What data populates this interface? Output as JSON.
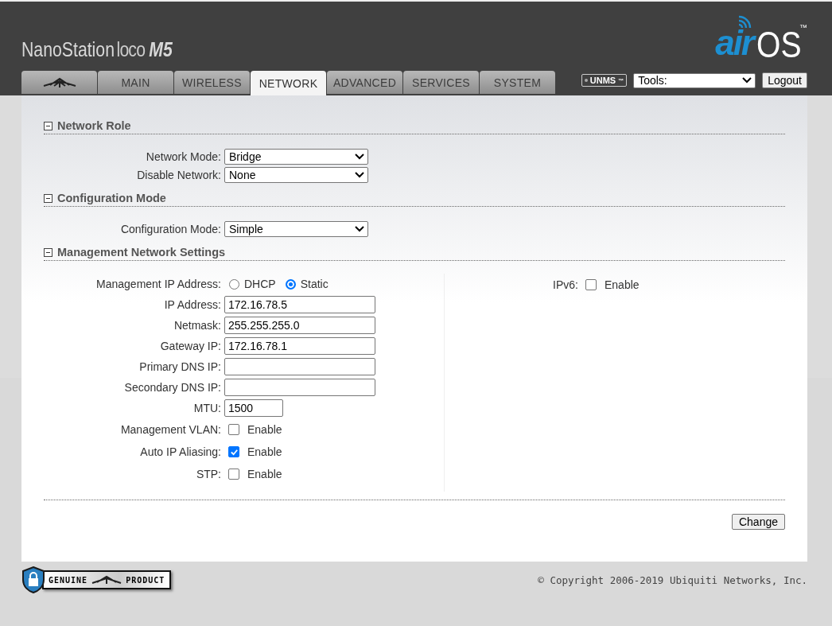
{
  "header": {
    "product_logo": {
      "name": "NanoStation",
      "variant": "loco",
      "model": "M5"
    },
    "brand_logo": {
      "prefix": "air",
      "suffix": "OS",
      "mark": "™"
    }
  },
  "tabs": [
    {
      "kind": "logo",
      "selected": false
    },
    {
      "kind": "text",
      "label": "MAIN",
      "selected": false
    },
    {
      "kind": "text",
      "label": "WIRELESS",
      "selected": false
    },
    {
      "kind": "text",
      "label": "NETWORK",
      "selected": true
    },
    {
      "kind": "text",
      "label": "ADVANCED",
      "selected": false
    },
    {
      "kind": "text",
      "label": "SERVICES",
      "selected": false
    },
    {
      "kind": "text",
      "label": "SYSTEM",
      "selected": false
    }
  ],
  "toolbar": {
    "unms": {
      "label": "UNMS",
      "mark": "™"
    },
    "tools": {
      "value": "Tools:"
    },
    "logout": "Logout"
  },
  "sections": [
    {
      "title": "Network Role",
      "expanded": true,
      "columns": [
        [
          {
            "kind": "select",
            "label": "Network Mode:",
            "value": "Bridge"
          },
          {
            "kind": "select",
            "label": "Disable Network:",
            "value": "None"
          }
        ]
      ]
    },
    {
      "title": "Configuration Mode",
      "expanded": true,
      "columns": [
        [
          {
            "kind": "select",
            "label": "Configuration Mode:",
            "value": "Simple"
          }
        ]
      ]
    },
    {
      "title": "Management Network Settings",
      "expanded": true,
      "columns": [
        [
          {
            "kind": "radio",
            "label": "Management IP Address:",
            "options": [
              {
                "label": "DHCP",
                "selected": false
              },
              {
                "label": "Static",
                "selected": true
              }
            ]
          },
          {
            "kind": "text",
            "label": "IP Address:",
            "value": "172.16.78.5"
          },
          {
            "kind": "text",
            "label": "Netmask:",
            "value": "255.255.255.0"
          },
          {
            "kind": "text",
            "label": "Gateway IP:",
            "value": "172.16.78.1"
          },
          {
            "kind": "text",
            "label": "Primary DNS IP:"
          },
          {
            "kind": "text",
            "label": "Secondary DNS IP:"
          },
          {
            "kind": "short",
            "label": "MTU:",
            "value": "1500"
          },
          {
            "kind": "checkbox",
            "label": "Management VLAN:",
            "text": "Enable",
            "checked": false
          },
          {
            "kind": "checkbox",
            "label": "Auto IP Aliasing:",
            "text": "Enable",
            "checked": true
          },
          {
            "kind": "checkbox",
            "label": "STP:",
            "text": "Enable",
            "checked": false
          }
        ],
        [
          {
            "kind": "checkbox",
            "label": "IPv6:",
            "text": "Enable",
            "checked": false
          }
        ]
      ]
    }
  ],
  "change_button": "Change",
  "footer": {
    "badge": {
      "left": "GENUINE",
      "right": "PRODUCT"
    },
    "copyright": "© Copyright 2006-2019 Ubiquiti Networks, Inc."
  }
}
